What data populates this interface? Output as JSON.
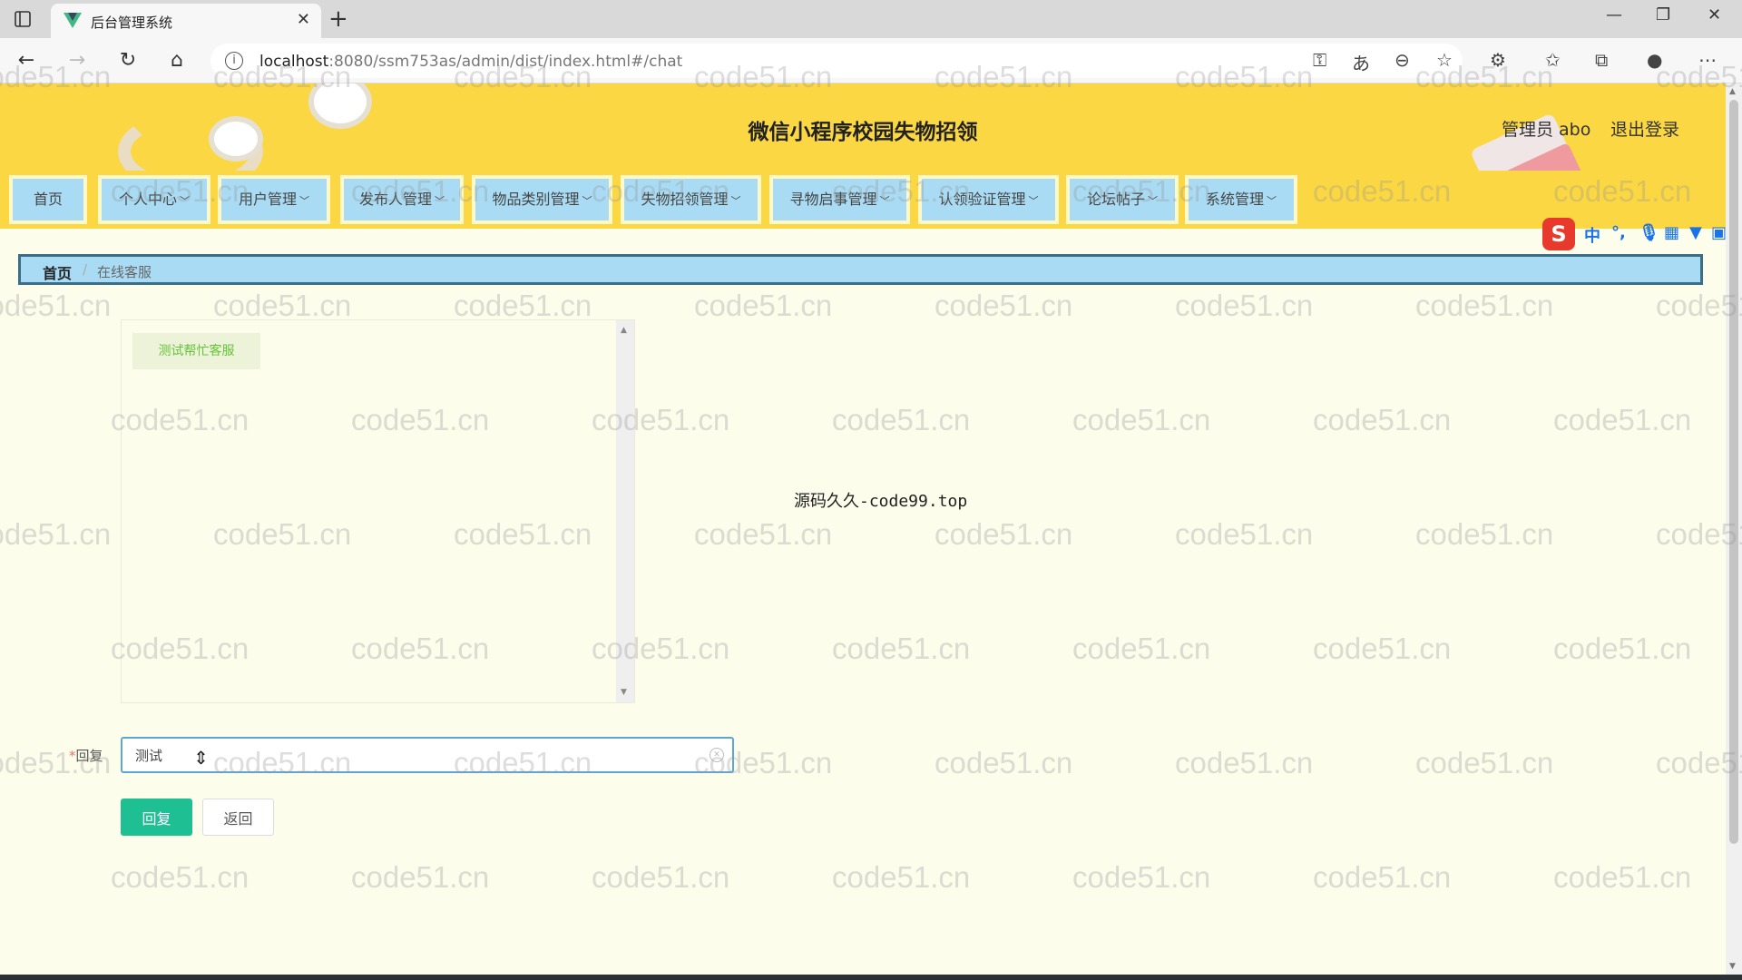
{
  "browser": {
    "tab_title": "后台管理系统",
    "url_host": "localhost",
    "url_rest": ":8080/ssm753as/admin/dist/index.html#/chat"
  },
  "header": {
    "title": "微信小程序校园失物招领",
    "admin_label": "管理员 abo",
    "logout_label": "退出登录"
  },
  "menu": {
    "items": [
      {
        "label": "首页",
        "dropdown": false
      },
      {
        "label": "个人中心",
        "dropdown": true
      },
      {
        "label": "用户管理",
        "dropdown": true
      },
      {
        "label": "发布人管理",
        "dropdown": true
      },
      {
        "label": "物品类别管理",
        "dropdown": true
      },
      {
        "label": "失物招领管理",
        "dropdown": true
      },
      {
        "label": "寻物启事管理",
        "dropdown": true
      },
      {
        "label": "认领验证管理",
        "dropdown": true
      },
      {
        "label": "论坛帖子",
        "dropdown": true
      },
      {
        "label": "系统管理",
        "dropdown": true
      }
    ]
  },
  "ime": {
    "logo": "S",
    "mode": "中"
  },
  "breadcrumb": {
    "home": "首页",
    "separator": "/",
    "current": "在线客服"
  },
  "chat": {
    "messages": [
      "测试帮忙客服"
    ]
  },
  "center_watermark": "源码久久-code99.top",
  "form": {
    "reply_label": "回复",
    "required_mark": "*",
    "reply_value": "测试",
    "submit_label": "回复",
    "back_label": "返回"
  },
  "watermark_text": "code51.cn",
  "colors": {
    "header_bg": "#fbd743",
    "menu_item_bg": "#a9dcf4",
    "primary_button": "#1fbf94",
    "page_bg": "#fdfdec"
  }
}
